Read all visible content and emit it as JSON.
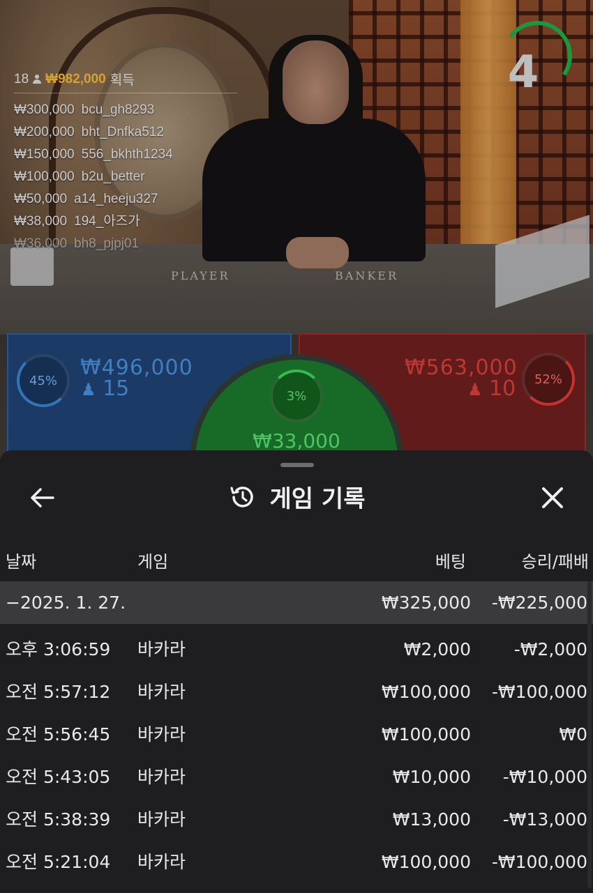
{
  "video": {
    "timer_value": "4",
    "table_left_label": "PLAYER",
    "table_right_label": "BANKER"
  },
  "winners": {
    "count": "18",
    "total": "₩982,000",
    "suffix": "획득",
    "rows": [
      {
        "amount": "₩300,000",
        "user": "bcu_gh8293"
      },
      {
        "amount": "₩200,000",
        "user": "bht_Dnfka512"
      },
      {
        "amount": "₩150,000",
        "user": "556_bkhth1234"
      },
      {
        "amount": "₩100,000",
        "user": "b2u_better"
      },
      {
        "amount": "₩50,000",
        "user": "a14_heeju327"
      },
      {
        "amount": "₩38,000",
        "user": "194_아즈가"
      },
      {
        "amount": "₩36,000",
        "user": "bh8_pjpj01"
      }
    ]
  },
  "bets": {
    "player": {
      "percent": "45%",
      "amount": "₩496,000",
      "players": "15",
      "percent_value": 45
    },
    "banker": {
      "percent": "52%",
      "amount": "₩563,000",
      "players": "10",
      "percent_value": 52
    },
    "tie": {
      "percent": "3%",
      "amount": "₩33,000",
      "percent_value": 3
    }
  },
  "sheet": {
    "title": "게임 기록",
    "columns": {
      "date": "날짜",
      "game": "게임",
      "bet": "베팅",
      "result": "승리/패배"
    },
    "summary": {
      "date": "−2025. 1. 27.",
      "bet": "₩325,000",
      "result": "-₩225,000"
    },
    "rows": [
      {
        "time": "오후 3:06:59",
        "game": "바카라",
        "bet": "₩2,000",
        "result": "-₩2,000"
      },
      {
        "time": "오전 5:57:12",
        "game": "바카라",
        "bet": "₩100,000",
        "result": "-₩100,000"
      },
      {
        "time": "오전 5:56:45",
        "game": "바카라",
        "bet": "₩100,000",
        "result": "₩0"
      },
      {
        "time": "오전 5:43:05",
        "game": "바카라",
        "bet": "₩10,000",
        "result": "-₩10,000"
      },
      {
        "time": "오전 5:38:39",
        "game": "바카라",
        "bet": "₩13,000",
        "result": "-₩13,000"
      },
      {
        "time": "오전 5:21:04",
        "game": "바카라",
        "bet": "₩100,000",
        "result": "-₩100,000"
      }
    ]
  },
  "icons": {
    "back": "arrow-left-icon",
    "history": "history-icon",
    "close": "close-icon",
    "person": "person-icon"
  },
  "colors": {
    "player_blue": "#2c62a5",
    "banker_red": "#a02b2a",
    "tie_green": "#1b7a2d",
    "winner_gold": "#f2b83a",
    "timer_green": "#1fae48"
  }
}
